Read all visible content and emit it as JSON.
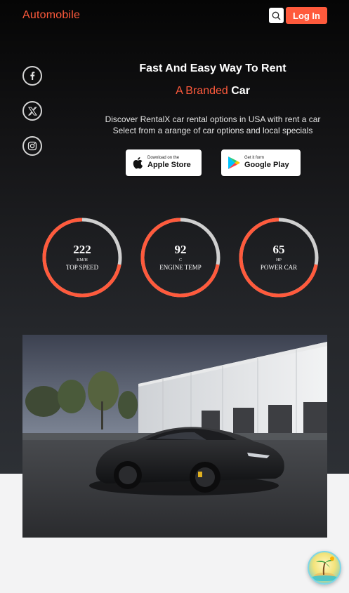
{
  "header": {
    "brand": "Automobile",
    "login_label": "Log In",
    "search_icon": "search-icon"
  },
  "social": [
    {
      "name": "facebook-icon"
    },
    {
      "name": "x-twitter-icon"
    },
    {
      "name": "instagram-icon"
    }
  ],
  "hero": {
    "title": "Fast And Easy Way To Rent",
    "subtitle_accent": "A Branded",
    "subtitle_rest": "Car",
    "desc_line1": "Discover RentalX car rental options in USA with rent a car",
    "desc_line2": "Select from a arange of car options and local specials"
  },
  "stores": {
    "apple_small": "Download on the",
    "apple_big": "Apple Store",
    "google_small": "Get it form",
    "google_big": "Google Play"
  },
  "gauges": [
    {
      "value": "222",
      "unit": "KM/H",
      "label": "TOP SPEED",
      "fill": 0.72
    },
    {
      "value": "92",
      "unit": "C",
      "label": "ENGINE TEMP",
      "fill": 0.72
    },
    {
      "value": "65",
      "unit": "HP",
      "label": "POWER CAR",
      "fill": 0.72
    }
  ],
  "colors": {
    "accent": "#ff5a3c",
    "gauge_track": "#cfcfcf"
  }
}
